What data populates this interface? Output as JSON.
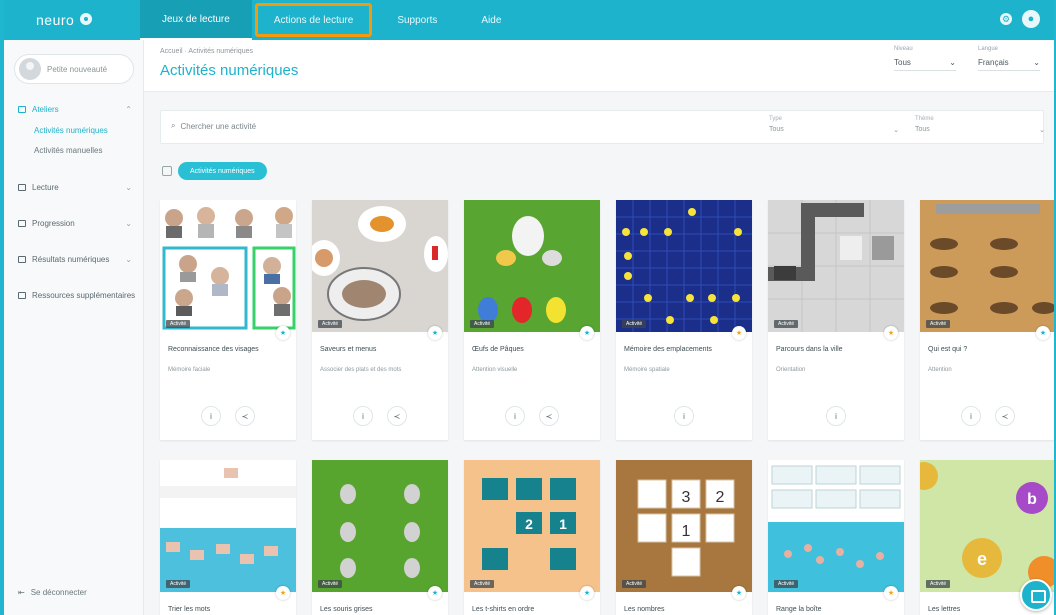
{
  "app": {
    "logo_text": "neuro"
  },
  "topnav": {
    "tabs": [
      {
        "label": "Jeux de lecture",
        "active": true
      },
      {
        "label": "Actions de lecture",
        "highlight": true
      },
      {
        "label": "Supports"
      },
      {
        "label": "Aide"
      }
    ]
  },
  "sidebar": {
    "profile_label": "Petite nouveauté",
    "sections": [
      {
        "label": "Ateliers",
        "subitems": [
          "Activités numériques",
          "Activités manuelles"
        ]
      },
      {
        "label": "Lecture"
      },
      {
        "label": "Progression"
      },
      {
        "label": "Résultats numériques"
      },
      {
        "label": "Ressources supplémentaires"
      }
    ],
    "logout": "Se déconnecter"
  },
  "header": {
    "breadcrumb": "Accueil · Activités numériques",
    "title": "Activités numériques",
    "selector1": {
      "label": "Niveau",
      "value": "Tous"
    },
    "selector2": {
      "label": "Langue",
      "value": "Français"
    }
  },
  "filters": {
    "search_placeholder": "Chercher une activité",
    "filter1": {
      "label": "Type",
      "value": "Tous"
    },
    "filter2": {
      "label": "Thème",
      "value": "Tous"
    }
  },
  "tag": {
    "label": "Activités numériques"
  },
  "cards": [
    {
      "title": "Reconnaissance des visages",
      "subtitle": "Mémoire faciale",
      "badge": "Activité",
      "corner": "★",
      "gold": false
    },
    {
      "title": "Saveurs et menus",
      "subtitle": "Associer des plats et des mots",
      "badge": "Activité",
      "corner": "★",
      "gold": false
    },
    {
      "title": "Œufs de Pâques",
      "subtitle": "Attention visuelle",
      "badge": "Activité",
      "corner": "★",
      "gold": false
    },
    {
      "title": "Mémoire des emplacements",
      "subtitle": "Mémoire spatiale",
      "badge": "Activité",
      "corner": "★",
      "gold": true
    },
    {
      "title": "Parcours dans la ville",
      "subtitle": "Orientation",
      "badge": "Activité",
      "corner": "★",
      "gold": true
    },
    {
      "title": "Qui est qui ?",
      "subtitle": "Attention",
      "badge": "Activité",
      "corner": "★",
      "gold": false
    },
    {
      "title": "Trier les mots",
      "badge": "Activité",
      "corner": "★",
      "gold": true
    },
    {
      "title": "Les souris grises",
      "badge": "Activité",
      "corner": "★",
      "gold": false
    },
    {
      "title": "Les t-shirts en ordre",
      "badge": "Activité",
      "corner": "★",
      "gold": false
    },
    {
      "title": "Les nombres",
      "badge": "Activité",
      "corner": "★",
      "gold": false
    },
    {
      "title": "Range la boîte",
      "badge": "Activité",
      "corner": "★",
      "gold": true
    },
    {
      "title": "Les lettres",
      "badge": "Activité",
      "corner": "★",
      "gold": false
    }
  ],
  "thumb_text": {
    "numbers": [
      "3",
      "2",
      "1"
    ],
    "tshirt_numbers": [
      "2",
      "1"
    ],
    "letters": [
      "b",
      "e"
    ]
  },
  "icons": {
    "info": "info-icon",
    "share": "share-icon",
    "chat": "chat-icon"
  }
}
